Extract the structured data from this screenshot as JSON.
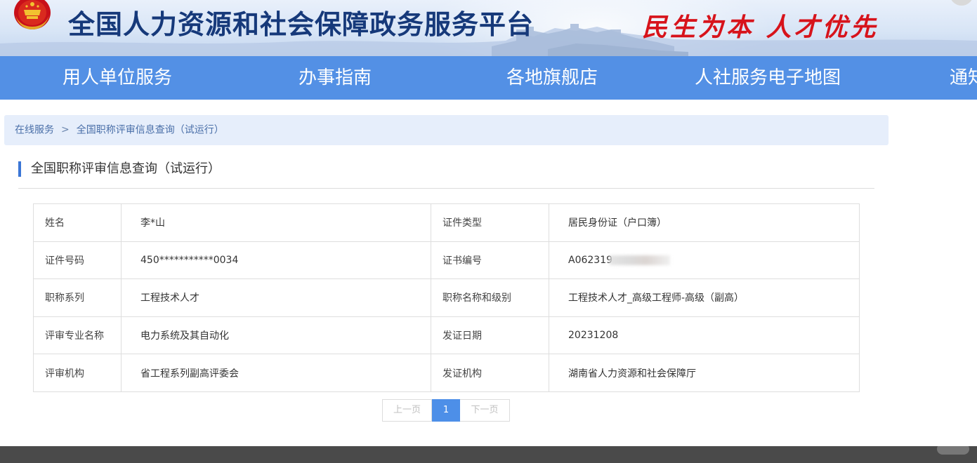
{
  "header": {
    "site_title": "全国人力资源和社会保障政务服务平台",
    "slogan": "民生为本 人才优先"
  },
  "nav": {
    "items": [
      {
        "label": "用人单位服务"
      },
      {
        "label": "办事指南"
      },
      {
        "label": "各地旗舰店"
      },
      {
        "label": "人社服务电子地图"
      },
      {
        "label": "通知"
      }
    ]
  },
  "breadcrumb": {
    "items": [
      "在线服务",
      "全国职称评审信息查询（试运行）"
    ],
    "separator": ">"
  },
  "section": {
    "title": "全国职称评审信息查询（试运行）"
  },
  "record": {
    "rows": [
      {
        "label1": "姓名",
        "value1": "李*山",
        "label2": "证件类型",
        "value2": "居民身份证（户口簿）"
      },
      {
        "label1": "证件号码",
        "value1": "450***********0034",
        "label2": "证书编号",
        "value2": "A062319"
      },
      {
        "label1": "职称系列",
        "value1": "工程技术人才",
        "label2": "职称名称和级别",
        "value2": "工程技术人才_高级工程师-高级（副高）"
      },
      {
        "label1": "评审专业名称",
        "value1": "电力系统及其自动化",
        "label2": "发证日期",
        "value2": "20231208"
      },
      {
        "label1": "评审机构",
        "value1": "省工程系列副高评委会",
        "label2": "发证机构",
        "value2": "湖南省人力资源和社会保障厅"
      }
    ]
  },
  "pagination": {
    "prev_label": "上一页",
    "current_page": "1",
    "next_label": "下一页"
  },
  "theme": {
    "nav_bg": "#5390e5",
    "title_color": "#16397a",
    "slogan_color": "#d7131b",
    "accent": "#3b76d6"
  },
  "icons": {
    "emblem": "national-emblem-icon"
  }
}
